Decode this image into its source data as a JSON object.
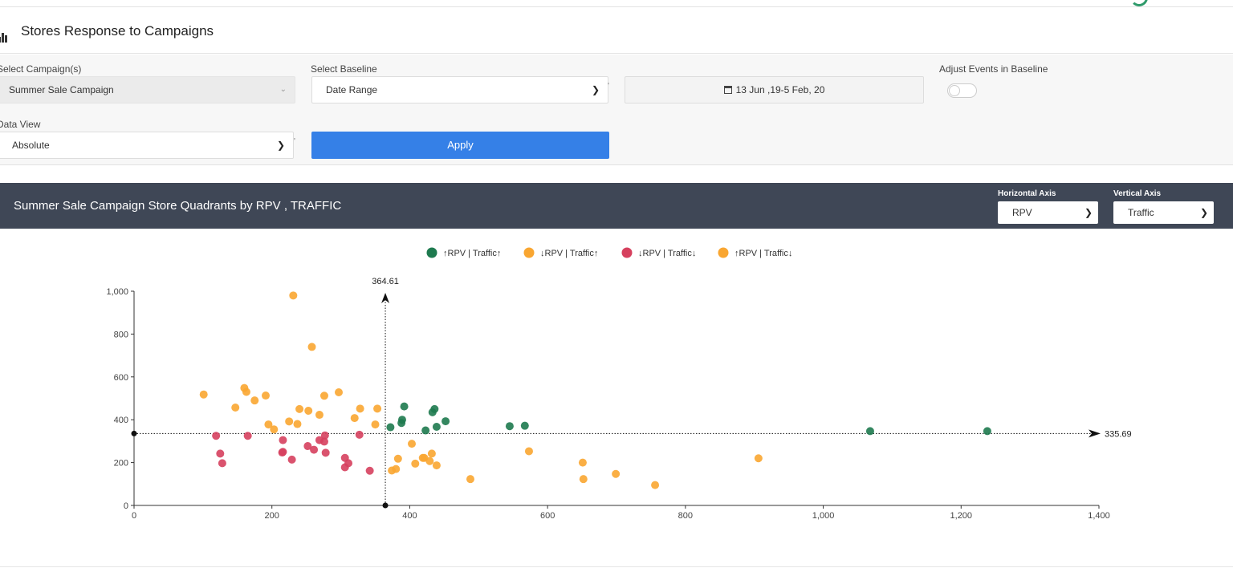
{
  "page": {
    "title": "Stores Response to Campaigns"
  },
  "filters": {
    "campaign_label": "Select Campaign(s)",
    "campaign_value": "Summer Sale Campaign",
    "baseline_label": "Select Baseline",
    "baseline_value": "Date Range",
    "date_range": "13 Jun ,19-5 Feb, 20",
    "adjust_label": "Adjust Events in Baseline",
    "adjust_enabled": false,
    "dataview_label": "Data View",
    "dataview_value": "Absolute",
    "apply_label": "Apply"
  },
  "chart_header": {
    "title": "Summer Sale Campaign Store Quadrants by RPV , TRAFFIC",
    "h_axis_label": "Horizontal Axis",
    "h_axis_value": "RPV",
    "v_axis_label": "Vertical Axis",
    "v_axis_value": "Traffic"
  },
  "chart_data": {
    "type": "scatter",
    "title": "",
    "xlabel": "",
    "ylabel": "",
    "xlim": [
      0,
      1400
    ],
    "ylim": [
      0,
      1000
    ],
    "x_ticks": [
      "0",
      "200",
      "400",
      "600",
      "800",
      "1,000",
      "1,200",
      "1,400"
    ],
    "y_ticks": [
      "0",
      "200",
      "400",
      "600",
      "800",
      "1,000"
    ],
    "legend_position": "top-center",
    "grid": false,
    "reference_lines": {
      "vertical": {
        "x": 364.61,
        "label": "364.61"
      },
      "horizontal": {
        "y": 335.69,
        "label": "335.69"
      }
    },
    "series": [
      {
        "name": "↑RPV | Traffic↑",
        "color": "#1e7a4f",
        "points": [
          [
            372,
            365
          ],
          [
            388,
            385
          ],
          [
            389,
            400
          ],
          [
            392,
            462
          ],
          [
            423,
            350
          ],
          [
            433,
            435
          ],
          [
            436,
            450
          ],
          [
            439,
            367
          ],
          [
            452,
            393
          ],
          [
            545,
            370
          ],
          [
            567,
            372
          ],
          [
            1068,
            347
          ],
          [
            1238,
            347
          ]
        ]
      },
      {
        "name": "↓RPV | Traffic↑",
        "color": "#f9a631",
        "points": [
          [
            101,
            518
          ],
          [
            147,
            457
          ],
          [
            160,
            548
          ],
          [
            163,
            530
          ],
          [
            175,
            490
          ],
          [
            191,
            513
          ],
          [
            195,
            378
          ],
          [
            203,
            355
          ],
          [
            225,
            392
          ],
          [
            231,
            980
          ],
          [
            237,
            380
          ],
          [
            240,
            450
          ],
          [
            253,
            442
          ],
          [
            258,
            740
          ],
          [
            269,
            423
          ],
          [
            276,
            512
          ],
          [
            297,
            528
          ],
          [
            320,
            408
          ],
          [
            328,
            452
          ],
          [
            350,
            378
          ],
          [
            353,
            452
          ]
        ]
      },
      {
        "name": "↓RPV | Traffic↓",
        "color": "#d6405e",
        "points": [
          [
            119,
            325
          ],
          [
            125,
            242
          ],
          [
            128,
            197
          ],
          [
            165,
            325
          ],
          [
            215,
            247
          ],
          [
            216,
            250
          ],
          [
            216,
            305
          ],
          [
            229,
            214
          ],
          [
            252,
            277
          ],
          [
            261,
            260
          ],
          [
            269,
            305
          ],
          [
            276,
            298
          ],
          [
            277,
            327
          ],
          [
            278,
            246
          ],
          [
            306,
            222
          ],
          [
            306,
            178
          ],
          [
            311,
            197
          ],
          [
            327,
            330
          ],
          [
            342,
            162
          ]
        ]
      },
      {
        "name": "↑RPV | Traffic↓",
        "color": "#f9a631",
        "points": [
          [
            374,
            163
          ],
          [
            380,
            170
          ],
          [
            383,
            218
          ],
          [
            403,
            288
          ],
          [
            408,
            195
          ],
          [
            419,
            222
          ],
          [
            421,
            222
          ],
          [
            429,
            207
          ],
          [
            432,
            242
          ],
          [
            439,
            187
          ],
          [
            488,
            123
          ],
          [
            573,
            253
          ],
          [
            651,
            200
          ],
          [
            652,
            123
          ],
          [
            699,
            147
          ],
          [
            756,
            95
          ],
          [
            906,
            220
          ]
        ]
      }
    ]
  }
}
